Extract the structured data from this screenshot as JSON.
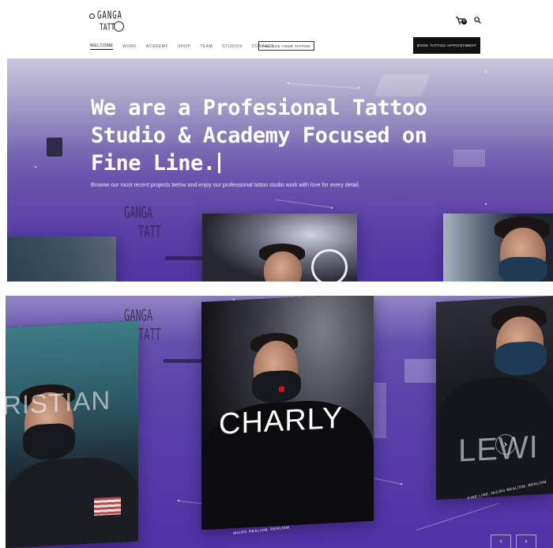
{
  "logo": {
    "line1": "GANGA",
    "line2": "TATT"
  },
  "header": {
    "nav": [
      "WELCOME",
      "WORK",
      "ACADEMY",
      "SHOP",
      "TEAM",
      "STUDIOS",
      "CONTACT"
    ],
    "finance_label": "FINANCE YOUR TATTOO",
    "book_label": "BOOK TATTOO APPOINTMENT",
    "cart_count": "0",
    "icons": [
      "cart-icon",
      "search-icon"
    ]
  },
  "hero": {
    "headline_line1": "We are a Profesional Tattoo",
    "headline_line2": "Studio & Academy Focused on",
    "headline_line3": "Fine Line.",
    "subtitle": "Browse our most recent projects below and enjoy our professional tattoo studio work with love for every detail.",
    "wall_logo_line1": "GANGA",
    "wall_logo_line2": "TATT"
  },
  "artists": {
    "left": {
      "name": "RISTIAN"
    },
    "center": {
      "name": "CHARLY",
      "styles": "MICRO REALISM, REALISM"
    },
    "right": {
      "name": "LEWI",
      "styles": "FINE LINE, MICRO REALISM, REALISM"
    },
    "next_icon": "chevron-right-icon",
    "pager": {
      "prev": "‹",
      "next": "›"
    }
  },
  "colors": {
    "accent_purple": "#5a3fa8",
    "header_bg": "#ffffff",
    "button_dark": "#111111"
  }
}
